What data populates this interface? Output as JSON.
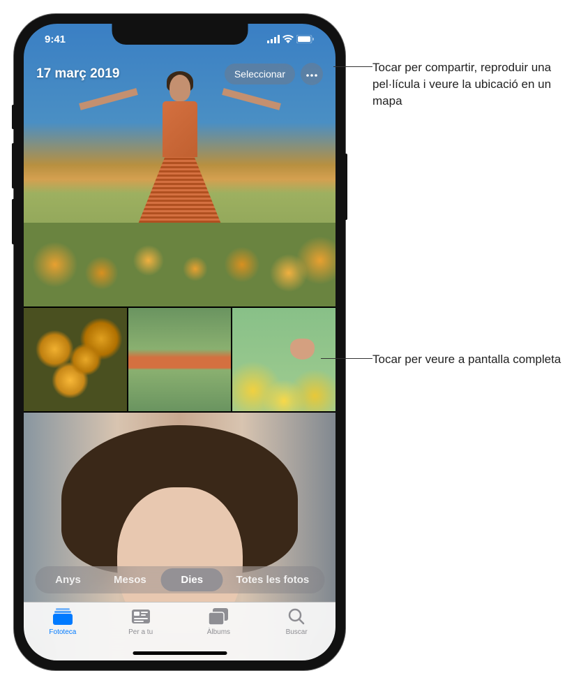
{
  "status": {
    "time": "9:41"
  },
  "header": {
    "date_title": "17 març 2019",
    "select_label": "Seleccionar"
  },
  "segments": {
    "years": "Anys",
    "months": "Mesos",
    "days": "Dies",
    "all": "Totes les fotos"
  },
  "tabs": {
    "library": "Fototeca",
    "for_you": "Per a tu",
    "albums": "Àlbums",
    "search": "Buscar"
  },
  "callouts": {
    "more": "Tocar per compartir, reproduir una pel·lícula i veure la ubicació en un mapa",
    "thumb": "Tocar per veure a pantalla completa"
  }
}
